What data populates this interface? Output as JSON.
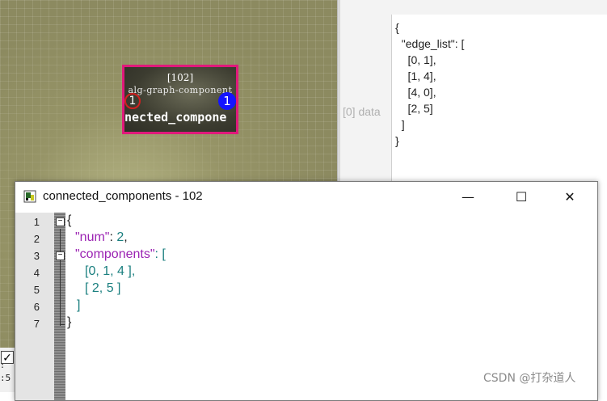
{
  "node": {
    "id_label": "[102]",
    "type_label": "alg-graph-component",
    "in_port": "1",
    "out_port": "1",
    "name": "nected_compone"
  },
  "right_panel": {
    "data_label": "[0] data",
    "json_lines": "{\n  \"edge_list\": [\n    [0, 1],\n    [1, 4],\n    [4, 0],\n    [2, 5]\n  ]\n}"
  },
  "bottom_left": {
    "checkbox_mark": "✓",
    "fragment_1": ":",
    "fragment_2": ":5"
  },
  "dialog": {
    "title": "connected_components - 102",
    "minimize": "—",
    "maximize": "☐",
    "close": "✕",
    "line_numbers": [
      "1",
      "2",
      "3",
      "4",
      "5",
      "6",
      "7"
    ],
    "code": {
      "l1": "{",
      "l2_key": "\"num\"",
      "l2_rest": ": ",
      "l2_val": "2",
      "l2_tail": ",",
      "l3_key": "\"components\"",
      "l3_rest": ": [",
      "l4_open": "[",
      "l4_vals": "0, 1, 4",
      "l4_close": " ],",
      "l5_open": "[",
      "l5_vals": " 2, 5",
      "l5_close": " ]",
      "l6": "]",
      "l7": "}"
    }
  },
  "watermark": "CSDN @打杂道人",
  "colors": {
    "node_border": "#e0197b",
    "port_out": "#1414ff",
    "json_key": "#9b23b3",
    "json_number": "#1a7f7f"
  }
}
